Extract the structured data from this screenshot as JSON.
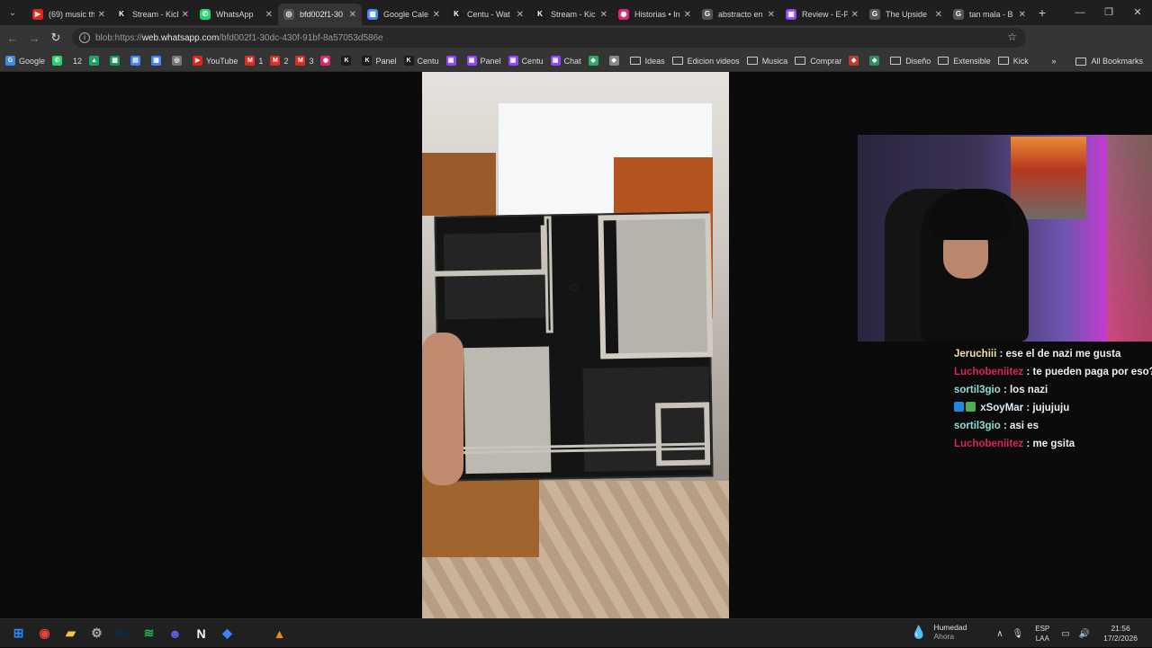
{
  "browser": {
    "tabs": [
      {
        "title": "(69) music th",
        "favicon": "youtube-icon",
        "color": "#e62117",
        "glyph": "▶"
      },
      {
        "title": "Stream - Kick",
        "favicon": "kick-icon",
        "color": "#1b1b1b",
        "glyph": "K"
      },
      {
        "title": "WhatsApp",
        "favicon": "whatsapp-icon",
        "color": "#25d366",
        "glyph": "✆"
      },
      {
        "title": "bfd002f1-30",
        "favicon": "globe-icon",
        "color": "#555",
        "glyph": "◎",
        "active": true
      },
      {
        "title": "Google Cale",
        "favicon": "calendar-icon",
        "color": "#4285f4",
        "glyph": "▦"
      },
      {
        "title": "Centu - Wat",
        "favicon": "kick-icon",
        "color": "#1b1b1b",
        "glyph": "K"
      },
      {
        "title": "Stream - Kic",
        "favicon": "kick-icon",
        "color": "#1b1b1b",
        "glyph": "K"
      },
      {
        "title": "Historias • In",
        "favicon": "instagram-icon",
        "color": "#d62976",
        "glyph": "◉"
      },
      {
        "title": "abstracto en",
        "favicon": "google-icon",
        "color": "#555",
        "glyph": "G"
      },
      {
        "title": "Review - E-P",
        "favicon": "twitch-icon",
        "color": "#9146ff",
        "glyph": "▣"
      },
      {
        "title": "The Upside",
        "favicon": "google-icon",
        "color": "#555",
        "glyph": "G"
      },
      {
        "title": "tan mala - B",
        "favicon": "google-icon",
        "color": "#555",
        "glyph": "G"
      }
    ],
    "url_scheme": "blob:https://",
    "url_host": "web.whatsapp.com",
    "url_path": "/bfd002f1-30dc-430f-91bf-8a57053d586e"
  },
  "bookmarks": {
    "items": [
      {
        "label": "Google",
        "icon": "google-icon",
        "color": "#4285f4",
        "glyph": "G"
      },
      {
        "label": "",
        "icon": "whatsapp-icon",
        "color": "#25d366",
        "glyph": "✆"
      },
      {
        "label": "12",
        "icon": "",
        "color": "",
        "glyph": ""
      },
      {
        "label": "",
        "icon": "drive-icon",
        "color": "#1fa463",
        "glyph": "▲"
      },
      {
        "label": "",
        "icon": "sheets-icon",
        "color": "#0f9d58",
        "glyph": "▦"
      },
      {
        "label": "",
        "icon": "docs-icon",
        "color": "#4285f4",
        "glyph": "▤"
      },
      {
        "label": "",
        "icon": "calendar-icon",
        "color": "#4285f4",
        "glyph": "▦"
      },
      {
        "label": "",
        "icon": "instagram-icon",
        "color": "#777",
        "glyph": "◎"
      },
      {
        "label": "YouTube",
        "icon": "youtube-icon",
        "color": "#e62117",
        "glyph": "▶"
      },
      {
        "label": "1",
        "icon": "gmail-icon",
        "color": "#d93025",
        "glyph": "M"
      },
      {
        "label": "2",
        "icon": "gmail-icon",
        "color": "#d93025",
        "glyph": "M"
      },
      {
        "label": "3",
        "icon": "gmail-icon",
        "color": "#d93025",
        "glyph": "M"
      },
      {
        "label": "",
        "icon": "instagram-icon",
        "color": "#d62976",
        "glyph": "◉"
      },
      {
        "label": "",
        "icon": "kick-icon",
        "color": "#1b1b1b",
        "glyph": "K"
      },
      {
        "label": "Panel",
        "icon": "kick-icon",
        "color": "#1b1b1b",
        "glyph": "K"
      },
      {
        "label": "Centu",
        "icon": "kick-icon",
        "color": "#1b1b1b",
        "glyph": "K"
      },
      {
        "label": "",
        "icon": "twitch-icon",
        "color": "#9146ff",
        "glyph": "▣"
      },
      {
        "label": "Panel",
        "icon": "twitch-icon",
        "color": "#9146ff",
        "glyph": "▣"
      },
      {
        "label": "Centu",
        "icon": "twitch-icon",
        "color": "#9146ff",
        "glyph": "▣"
      },
      {
        "label": "Chat",
        "icon": "twitch-icon",
        "color": "#9146ff",
        "glyph": "▣"
      },
      {
        "label": "",
        "icon": "app-icon",
        "color": "#27ae60",
        "glyph": "◆"
      },
      {
        "label": "",
        "icon": "app-icon",
        "color": "#888",
        "glyph": "◆"
      }
    ],
    "folders": [
      "Ideas",
      "Edicion videos",
      "Musica",
      "Comprar"
    ],
    "folders2": [
      "Diseño",
      "Extensible",
      "Kick"
    ],
    "all_bookmarks": "All Bookmarks"
  },
  "chat": {
    "messages": [
      {
        "user": "Jeruchiii",
        "color": "#f2e3a0",
        "text": " : ese el de nazi me gusta",
        "badge": false
      },
      {
        "user": "Luchobeniitez",
        "color": "#e0245e",
        "text": " : te pueden paga por eso?",
        "badge": false
      },
      {
        "user": "sortil3gio",
        "color": "#8ee0d6",
        "text": " : los nazi",
        "badge": false
      },
      {
        "user": "xSoyMar",
        "color": "#dff0ff",
        "text": " : jujujuju",
        "badge": true
      },
      {
        "user": "sortil3gio",
        "color": "#8ee0d6",
        "text": " : asi es",
        "badge": false
      },
      {
        "user": "Luchobeniitez",
        "color": "#e0245e",
        "text": " : me gsita",
        "badge": false
      }
    ]
  },
  "taskbar": {
    "apps": [
      {
        "name": "windows-start-icon",
        "color": "#1e90ff",
        "glyph": "⊞"
      },
      {
        "name": "chrome-icon",
        "color": "#ea4335",
        "glyph": "◉"
      },
      {
        "name": "file-explorer-icon",
        "color": "#f4c542",
        "glyph": "▰"
      },
      {
        "name": "settings-icon",
        "color": "#aaa",
        "glyph": "⚙"
      },
      {
        "name": "photoshop-icon",
        "color": "#0b2a4a",
        "glyph": "Ps"
      },
      {
        "name": "spotify-icon",
        "color": "#1db954",
        "glyph": "≋"
      },
      {
        "name": "discord-icon",
        "color": "#5865f2",
        "glyph": "☻"
      },
      {
        "name": "notion-icon",
        "color": "#fff",
        "glyph": "N"
      },
      {
        "name": "app-icon",
        "color": "#3b82f6",
        "glyph": "◆"
      },
      {
        "name": "capcut-icon",
        "color": "#222",
        "glyph": "⟲"
      },
      {
        "name": "vlc-icon",
        "color": "#f08a00",
        "glyph": "▲"
      }
    ],
    "weather_label": "Humedad",
    "weather_sub": "Ahora",
    "lang_top": "ESP",
    "lang_bottom": "LAA",
    "time": "21:56",
    "date": "17/2/2026"
  }
}
